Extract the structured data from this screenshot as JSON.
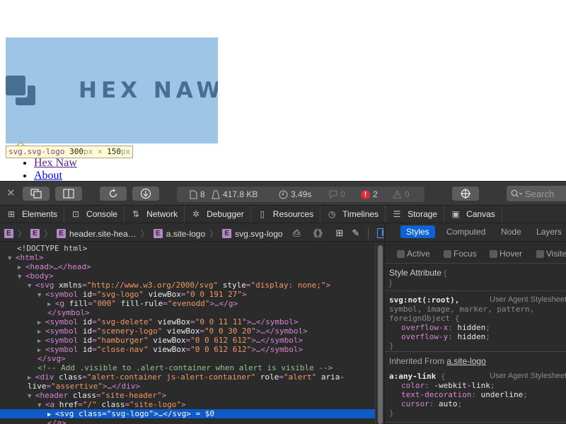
{
  "page": {
    "logo_text": "HEX NAW",
    "tooltip": {
      "selector": "svg.svg-logo",
      "width": "300",
      "height": "150",
      "unit": "px",
      "times": "×"
    },
    "nav_links": [
      {
        "label": "Hex Naw",
        "state": "visited"
      },
      {
        "label": "About",
        "state": "link"
      }
    ],
    "colors": {
      "logo_bg": "#9ec5e5",
      "logo_fg": "#466f91",
      "selection": "#0e5bc7",
      "error": "#d8303a"
    }
  },
  "toolbar": {
    "close_icon": "close-icon",
    "buttons": [
      "dock-toggle-icon",
      "split-view-icon",
      "reload-icon",
      "download-icon"
    ],
    "status": {
      "resources_count": "8",
      "transfer_size": "417.8 KB",
      "load_time": "3.49s",
      "logs_count": "0",
      "errors_count": "2",
      "warnings_count": "0"
    },
    "inspect_icon": "crosshair-icon",
    "search_placeholder": "Search"
  },
  "tabs": [
    {
      "label": "Elements",
      "icon": "elements-icon"
    },
    {
      "label": "Console",
      "icon": "console-icon"
    },
    {
      "label": "Network",
      "icon": "network-icon"
    },
    {
      "label": "Debugger",
      "icon": "debugger-icon"
    },
    {
      "label": "Resources",
      "icon": "resources-icon"
    },
    {
      "label": "Timelines",
      "icon": "timelines-icon"
    },
    {
      "label": "Storage",
      "icon": "storage-icon"
    },
    {
      "label": "Canvas",
      "icon": "canvas-icon"
    },
    {
      "label": "Search",
      "icon": "search-icon"
    }
  ],
  "breadcrumbs": [
    {
      "badge": "E",
      "label": ""
    },
    {
      "badge": "E",
      "label": ""
    },
    {
      "badge": "E",
      "label": "header.site-hea…"
    },
    {
      "badge": "E",
      "label": "a.site-logo"
    },
    {
      "badge": "E",
      "label": "svg.svg-logo"
    }
  ],
  "dom": {
    "lines": [
      "<!DOCTYPE html>",
      "<html>",
      "<head>…</head>",
      "<body>",
      "<svg xmlns=\"http://www.w3.org/2000/svg\" style=\"display: none;\">",
      "<symbol id=\"svg-logo\" viewBox=\"0 0 191 27\">",
      "<g fill=\"000\" fill-rule=\"evenodd\">…</g>",
      "</symbol>",
      "<symbol id=\"svg-delete\" viewBox=\"0 0 11 11\">…</symbol>",
      "<symbol id=\"scenery-logo\" viewBox=\"0 0 30 20\">…</symbol>",
      "<symbol id=\"hamburger\" viewBox=\"0 0 612 612\">…</symbol>",
      "<symbol id=\"close-nav\" viewBox=\"0 0 612 612\">…</symbol>",
      "</svg>",
      "<!-- Add .visible to .alert-container when alert is visible -->",
      "<div class=\"alert-container js-alert-container\" role=\"alert\" aria-live=\"assertive\">…</div>",
      "<header class=\"site-header\">",
      "<a href=\"/\" class=\"site-logo\">",
      "<svg class=\"svg-logo\">…</svg> = $0",
      "</a>"
    ],
    "selected_suffix": " = $0"
  },
  "sidebar": {
    "tabs": [
      "Styles",
      "Computed",
      "Node",
      "Layers"
    ],
    "active_tab": "Styles",
    "pseudo_classes": [
      "Active",
      "Focus",
      "Hover",
      "Visited"
    ],
    "style_attribute": {
      "label": "Style Attribute",
      "open": "{",
      "close": "}"
    },
    "rules": [
      {
        "selector": "svg:not(:root),",
        "selector_rest_1": "symbol, image, marker, pattern,",
        "selector_rest_2": "foreignObject {",
        "origin": "User Agent Stylesheet",
        "props": [
          {
            "name": "overflow-x",
            "value": "hidden"
          },
          {
            "name": "overflow-y",
            "value": "hidden"
          }
        ]
      },
      {
        "selector": "a:any-link",
        "origin": "User Agent Stylesheet",
        "props": [
          {
            "name": "color",
            "value": "-webkit-link"
          },
          {
            "name": "text-decoration",
            "value": "underline"
          },
          {
            "name": "cursor",
            "value": "auto"
          }
        ]
      }
    ],
    "inherited_label": "Inherited From",
    "inherited_link": "a.site-logo"
  }
}
